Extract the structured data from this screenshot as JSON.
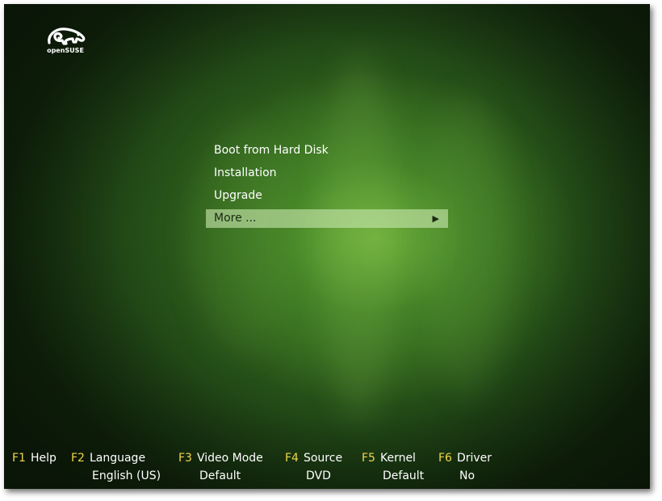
{
  "brand": {
    "logo_text": "openSUSE",
    "logo_color": "#ffffff"
  },
  "menu": {
    "items": [
      {
        "label": "Boot from Hard Disk",
        "selected": false
      },
      {
        "label": "Installation",
        "selected": false
      },
      {
        "label": "Upgrade",
        "selected": false
      },
      {
        "label": "More ...",
        "selected": true,
        "has_submenu": true,
        "icon": "arrow-right-icon"
      }
    ],
    "submenu_arrow": "▶"
  },
  "fkeys": [
    {
      "key": "F1",
      "label": "Help",
      "value": ""
    },
    {
      "key": "F2",
      "label": "Language",
      "value": "English (US)"
    },
    {
      "key": "F3",
      "label": "Video Mode",
      "value": "Default"
    },
    {
      "key": "F4",
      "label": "Source",
      "value": "DVD"
    },
    {
      "key": "F5",
      "label": "Kernel",
      "value": "Default"
    },
    {
      "key": "F6",
      "label": "Driver",
      "value": "No"
    }
  ],
  "colors": {
    "background": "#2c5c1b",
    "highlight": "#c8e6af",
    "fkey_accent": "#f0d54a",
    "text": "#ffffff"
  }
}
